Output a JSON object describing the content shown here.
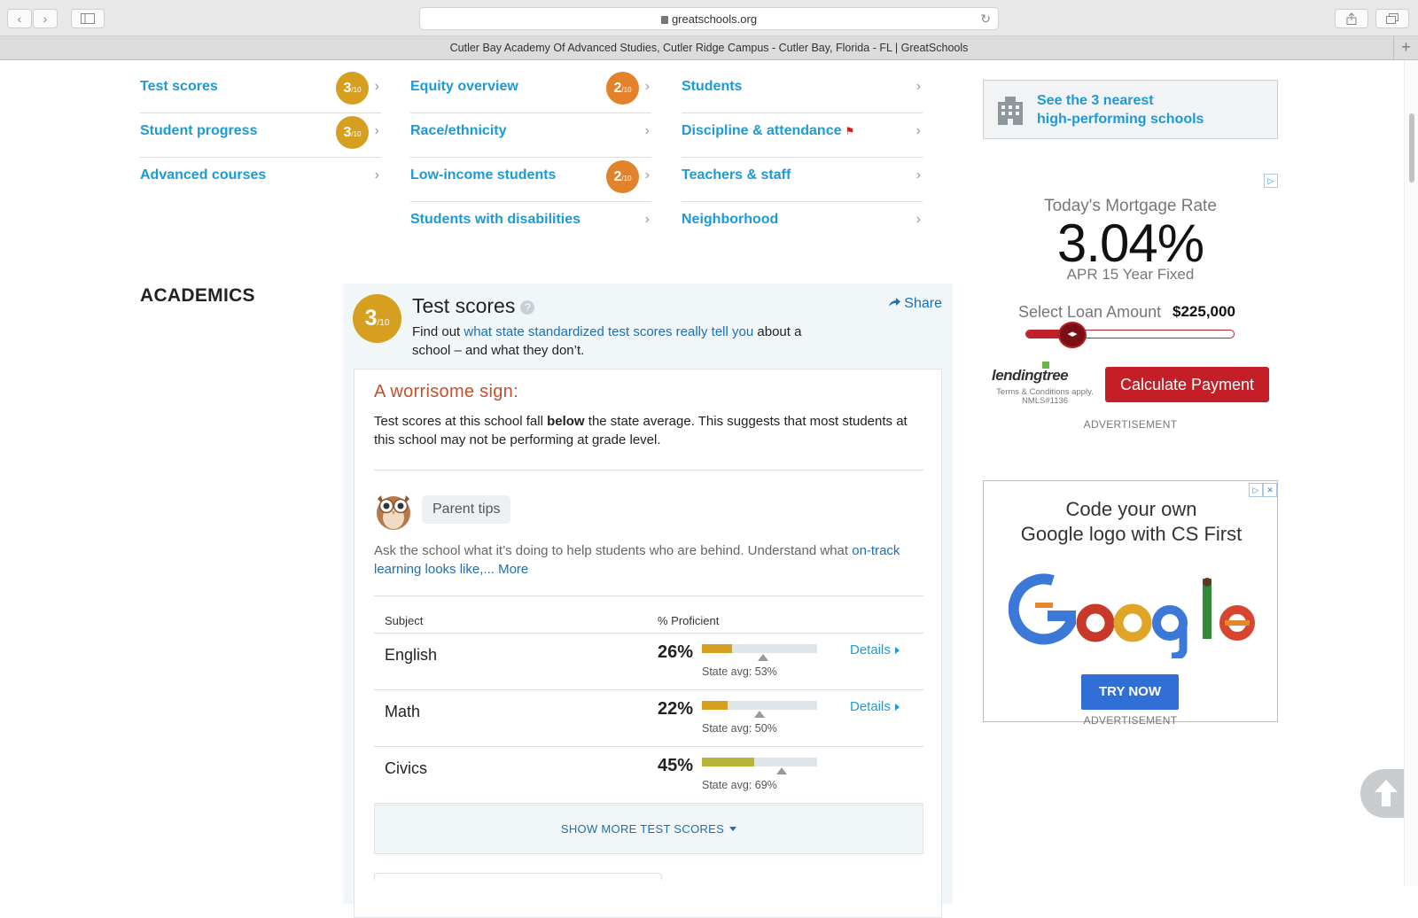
{
  "browser": {
    "url": "greatschools.org",
    "tab_title": "Cutler Bay Academy Of Advanced Studies, Cutler Ridge Campus - Cutler Bay, Florida - FL | GreatSchools",
    "back_icon": "‹",
    "forward_icon": "›",
    "reload_icon": "↻",
    "plus_icon": "+"
  },
  "nav": {
    "col1": [
      {
        "label": "Test scores",
        "rating": "3",
        "of": "/10",
        "color": "#d69f1f"
      },
      {
        "label": "Student progress",
        "rating": "3",
        "of": "/10",
        "color": "#d69f1f"
      },
      {
        "label": "Advanced courses"
      }
    ],
    "col2": [
      {
        "label": "Equity overview",
        "rating": "2",
        "of": "/10",
        "color": "#e3822b"
      },
      {
        "label": "Race/ethnicity"
      },
      {
        "label": "Low-income students",
        "rating": "2",
        "of": "/10",
        "color": "#e3822b"
      },
      {
        "label": "Students with disabilities"
      }
    ],
    "col3": [
      {
        "label": "Students"
      },
      {
        "label": "Discipline & attendance",
        "flag": "⚑"
      },
      {
        "label": "Teachers & staff"
      },
      {
        "label": "Neighborhood"
      }
    ],
    "chevron": "›"
  },
  "section_heading": "ACADEMICS",
  "test_scores": {
    "rating": "3",
    "of": "/10",
    "title": "Test scores",
    "help": "?",
    "share": "Share",
    "sub_prefix": "Find out ",
    "sub_link": "what state standardized test scores really tell you",
    "sub_suffix": " about a school – and what they don’t.",
    "warn_title": "A worrisome sign:",
    "warn_text_1": "Test scores at this school fall ",
    "warn_text_bold": "below",
    "warn_text_2": " the state average. This suggests that most students at this school may not be performing at grade level.",
    "tips_label": "Parent tips",
    "tips_text": "Ask the school what it’s doing to help students who are behind. Understand what ",
    "tips_link": "on-track learning looks like,... More",
    "col_subject": "Subject",
    "col_pct": "% Proficient",
    "rows": [
      {
        "subject": "English",
        "pct_label": "26%",
        "pct": 26,
        "state_avg": 53,
        "state_label": "State avg: 53%",
        "details": "Details",
        "fill_color": "#d69f1f"
      },
      {
        "subject": "Math",
        "pct_label": "22%",
        "pct": 22,
        "state_avg": 50,
        "state_label": "State avg: 50%",
        "details": "Details",
        "fill_color": "#d69f1f"
      },
      {
        "subject": "Civics",
        "pct_label": "45%",
        "pct": 45,
        "state_avg": 69,
        "state_label": "State avg: 69%",
        "fill_color": "#b7b33a"
      }
    ],
    "show_more": "SHOW MORE TEST SCORES"
  },
  "sidebar": {
    "nearest_line1": "See the 3 nearest",
    "nearest_line2": "high-performing schools",
    "ad1": {
      "label": "Today's Mortgage Rate",
      "rate": "3.04%",
      "apr": "APR 15 Year Fixed",
      "loan_label": "Select Loan Amount",
      "loan_amount": "$225,000",
      "slider_level": 0.21,
      "brand": "lendingtree",
      "terms": "Terms & Conditions apply. NMLS#1136",
      "cta": "Calculate Payment",
      "choice_icon": "▷"
    },
    "ad_label": "ADVERTISEMENT",
    "ad2": {
      "text_line1": "Code your own",
      "text_line2": "Google logo with CS First",
      "cta": "TRY NOW",
      "choice_icon": "▷",
      "close_icon": "✕"
    }
  },
  "colors": {
    "link": "#1d9ad6",
    "gold": "#d69f1f",
    "orange": "#e3822b",
    "warn": "#c84e2b",
    "ad_red": "#c41e26",
    "cta_blue": "#2f6fd6"
  }
}
